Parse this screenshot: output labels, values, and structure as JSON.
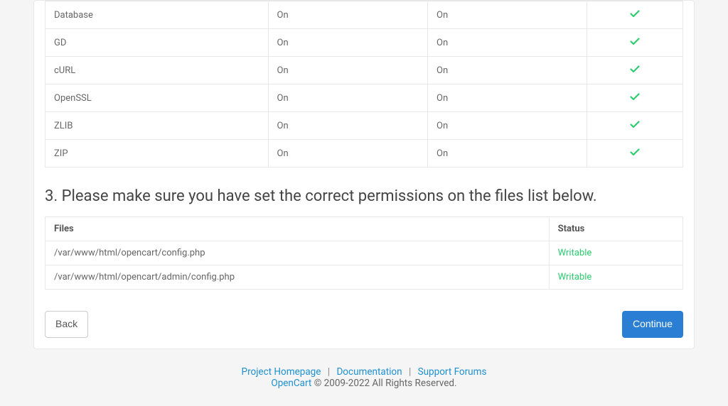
{
  "extensionsTable": {
    "rows": [
      {
        "name": "Database",
        "current": "On",
        "required": "On"
      },
      {
        "name": "GD",
        "current": "On",
        "required": "On"
      },
      {
        "name": "cURL",
        "current": "On",
        "required": "On"
      },
      {
        "name": "OpenSSL",
        "current": "On",
        "required": "On"
      },
      {
        "name": "ZLIB",
        "current": "On",
        "required": "On"
      },
      {
        "name": "ZIP",
        "current": "On",
        "required": "On"
      }
    ]
  },
  "section3": {
    "heading": "3. Please make sure you have set the correct permissions on the files list below.",
    "headers": {
      "files": "Files",
      "status": "Status"
    },
    "rows": [
      {
        "file": "/var/www/html/opencart/config.php",
        "status": "Writable"
      },
      {
        "file": "/var/www/html/opencart/admin/config.php",
        "status": "Writable"
      }
    ]
  },
  "buttons": {
    "back": "Back",
    "continue": "Continue"
  },
  "footer": {
    "home": "Project Homepage",
    "docs": "Documentation",
    "forums": "Support Forums",
    "brand": "OpenCart",
    "copyright": " © 2009-2022 All Rights Reserved."
  }
}
